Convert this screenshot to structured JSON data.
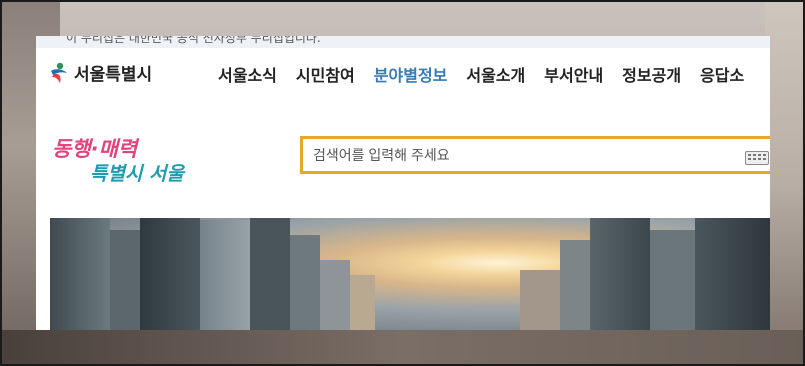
{
  "banner": {
    "text": "이 누리집은 대한민국 공식 전자정부 누리집입니다."
  },
  "logo": {
    "text": "서울특별시"
  },
  "nav": {
    "items": [
      {
        "label": "서울소식",
        "active": false
      },
      {
        "label": "시민참여",
        "active": false
      },
      {
        "label": "분야별정보",
        "active": true
      },
      {
        "label": "서울소개",
        "active": false
      },
      {
        "label": "부서안내",
        "active": false
      },
      {
        "label": "정보공개",
        "active": false
      },
      {
        "label": "응답소",
        "active": false
      }
    ]
  },
  "slogan": {
    "line1": "동행·매력",
    "line2": "특별시 서울"
  },
  "search": {
    "placeholder": "검색어를 입력해 주세요",
    "value": ""
  },
  "colors": {
    "accent": "#3a7ab3",
    "search_border": "#e4a92a",
    "slogan_pink": "#e0457b",
    "slogan_teal": "#1f9bb0"
  },
  "icons": {
    "logo": "seoul-logo-icon",
    "keyboard": "keyboard-icon"
  }
}
